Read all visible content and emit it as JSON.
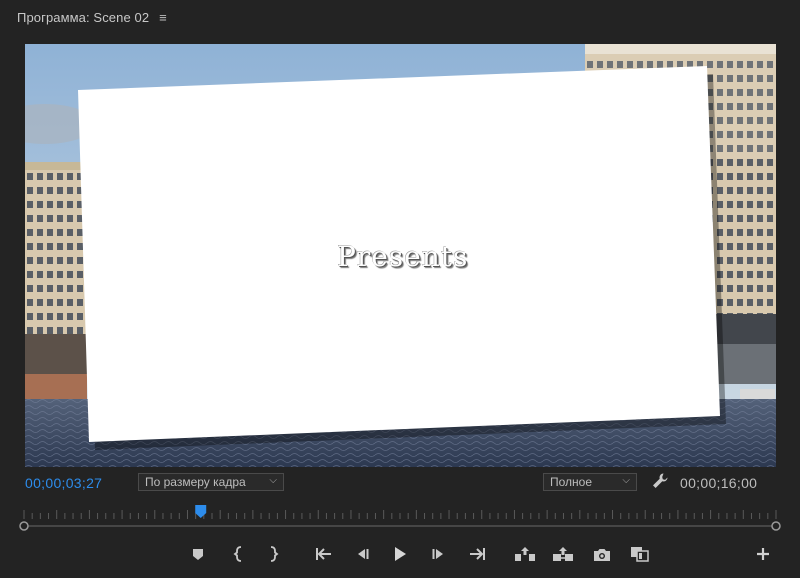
{
  "panel": {
    "title": "Программа: Scene 02",
    "menu_icon": "hamburger-icon"
  },
  "viewer": {
    "overlay_text": "Presents"
  },
  "controls": {
    "current_timecode": "00;00;03;27",
    "fit_dropdown": {
      "selected": "По размеру кадра"
    },
    "quality_dropdown": {
      "selected": "Полное"
    },
    "settings_icon": "wrench-icon",
    "duration_timecode": "00;00;16;00"
  },
  "playback": {
    "playhead_fraction": 0.235,
    "playhead_color": "#2d8ceb"
  },
  "transport": {
    "buttons": [
      "add-marker-icon",
      "mark-in-icon",
      "mark-out-icon",
      "go-to-in-icon",
      "step-back-icon",
      "play-icon",
      "step-forward-icon",
      "go-to-out-icon",
      "lift-icon",
      "extract-icon",
      "export-frame-icon",
      "comparison-view-icon",
      "add-button-icon"
    ]
  },
  "colors": {
    "accent": "#2d8ceb",
    "panel_bg": "#232323",
    "text": "#bdbdbd"
  }
}
